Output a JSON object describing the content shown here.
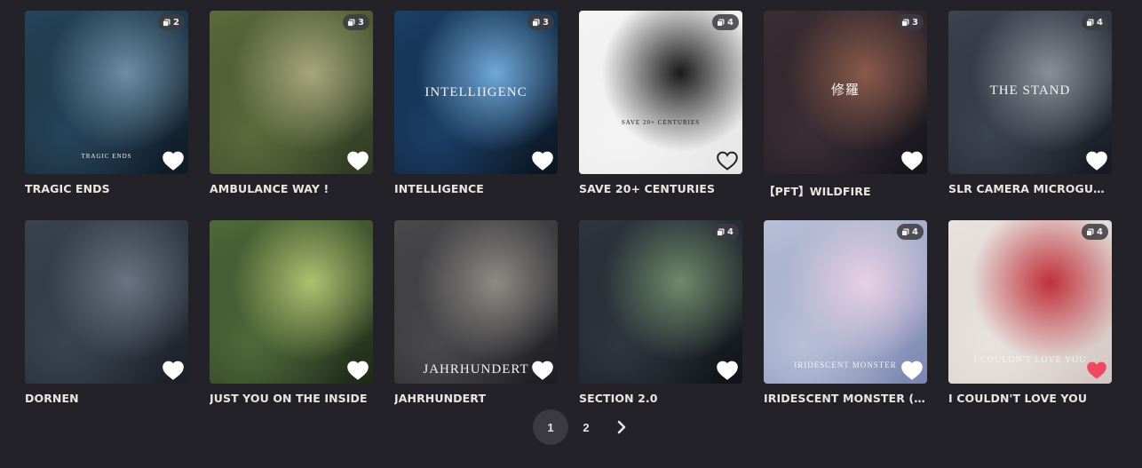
{
  "albums": [
    {
      "title": "TRAGIC ENDS",
      "count": "2",
      "liked": false,
      "art_text": "TRAGIC ENDS",
      "colors": [
        "#27445a",
        "#0e1a26",
        "#6d8ea4"
      ]
    },
    {
      "title": "AMBULANCE WAY !",
      "count": "3",
      "liked": false,
      "art_text": "",
      "colors": [
        "#5d6a3c",
        "#2f3a22",
        "#a5a67c"
      ]
    },
    {
      "title": "INTELLIGENCE",
      "count": "3",
      "liked": false,
      "art_text": "INTELLIIGENC",
      "colors": [
        "#1b3f66",
        "#0b1522",
        "#6fa8d8"
      ]
    },
    {
      "title": "SAVE 20+ CENTURIES",
      "count": "4",
      "liked": false,
      "art_text": "SAVE 20+ CENTURIES",
      "colors": [
        "#f4f4f4",
        "#e6e6e6",
        "#1a1a1a"
      ]
    },
    {
      "title": "【PFT】WILDFIRE",
      "count": "3",
      "liked": false,
      "art_text": "修羅",
      "colors": [
        "#3b2e34",
        "#14141c",
        "#8a5a4a"
      ]
    },
    {
      "title": "SLR CAMERA MICROGUN ...",
      "count": "4",
      "liked": false,
      "art_text": "THE STAND",
      "colors": [
        "#3c4450",
        "#161a22",
        "#8a8e98"
      ]
    },
    {
      "title": "DORNEN",
      "count": "",
      "liked": false,
      "art_text": "",
      "colors": [
        "#3a4450",
        "#1b2028",
        "#6a7482"
      ]
    },
    {
      "title": "JUST YOU ON THE INSIDE",
      "count": "",
      "liked": false,
      "art_text": "",
      "colors": [
        "#4e6a3a",
        "#1e2a18",
        "#b0c070"
      ]
    },
    {
      "title": "JAHRHUNDERT",
      "count": "",
      "liked": false,
      "art_text": "JAHRHUNDERT",
      "colors": [
        "#4a4a4c",
        "#1e1e22",
        "#8e8a86"
      ]
    },
    {
      "title": "SECTION 2.0",
      "count": "4",
      "liked": false,
      "art_text": "",
      "colors": [
        "#2e3640",
        "#101418",
        "#6e8a6a"
      ]
    },
    {
      "title": "IRIDESCENT MONSTER (A...",
      "count": "4",
      "liked": false,
      "art_text": "IRIDESCENT MONSTER",
      "colors": [
        "#b8c0d8",
        "#7a86b0",
        "#e8d0e4"
      ]
    },
    {
      "title": "I COULDN'T LOVE YOU",
      "count": "4",
      "liked": true,
      "art_text": "I COULDN'T LOVE YOU",
      "colors": [
        "#e8e2de",
        "#d4c8c4",
        "#c0303a"
      ]
    }
  ],
  "pagination": {
    "pages": [
      "1",
      "2"
    ],
    "current": "1"
  },
  "colors": {
    "background": "#232228",
    "heart_liked": "#f04a62",
    "heart_outline": "#ffffff"
  }
}
